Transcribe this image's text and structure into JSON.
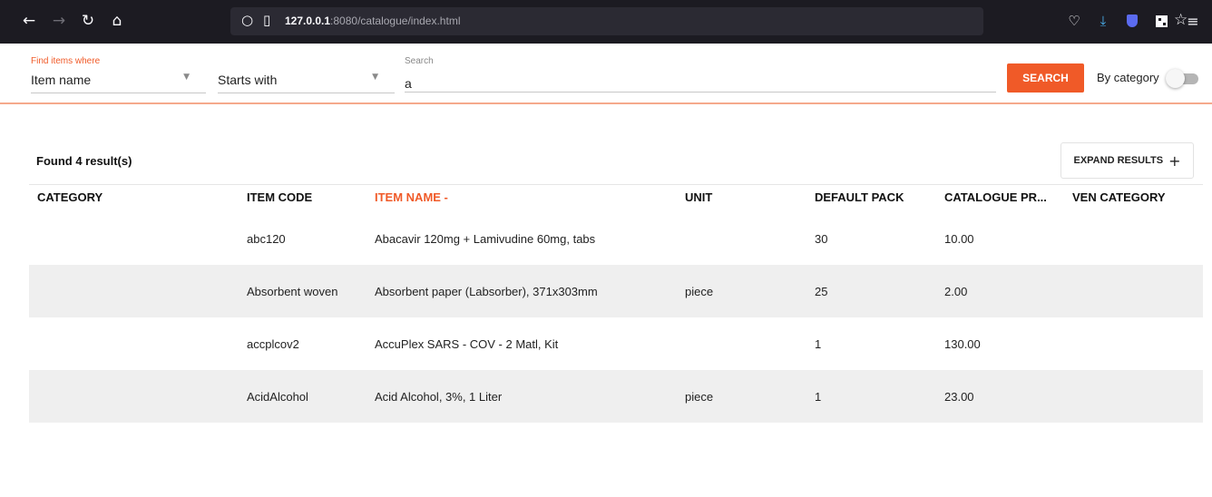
{
  "browser": {
    "url_host": "127.0.0.1",
    "url_rest": ":8080/catalogue/index.html"
  },
  "search": {
    "filter_label": "Find items where",
    "field_value": "Item name",
    "mode_value": "Starts with",
    "search_label": "Search",
    "query": "a",
    "button_label": "SEARCH",
    "category_toggle_label": "By category",
    "category_toggle_on": false
  },
  "results": {
    "count_label": "Found 4 result(s)",
    "expand_label": "EXPAND RESULTS",
    "columns": [
      {
        "label": "CATEGORY"
      },
      {
        "label": "ITEM CODE"
      },
      {
        "label": "ITEM NAME -"
      },
      {
        "label": "UNIT"
      },
      {
        "label": "DEFAULT PACK"
      },
      {
        "label": "CATALOGUE PR..."
      },
      {
        "label": "VEN CATEGORY"
      }
    ],
    "sorted_column": "ITEM NAME -",
    "rows": [
      {
        "category": "",
        "code": "abc120",
        "name": "Abacavir 120mg + Lamivudine 60mg, tabs",
        "unit": "",
        "pack": "30",
        "price": "10.00",
        "ven": ""
      },
      {
        "category": "",
        "code": "Absorbent woven",
        "name": "Absorbent paper (Labsorber), 371x303mm",
        "unit": "piece",
        "pack": "25",
        "price": "2.00",
        "ven": ""
      },
      {
        "category": "",
        "code": "accplcov2",
        "name": "AccuPlex SARS - COV - 2 Matl, Kit",
        "unit": "",
        "pack": "1",
        "price": "130.00",
        "ven": ""
      },
      {
        "category": "",
        "code": "AcidAlcohol",
        "name": "Acid Alcohol, 3%, 1 Liter",
        "unit": "piece",
        "pack": "1",
        "price": "23.00",
        "ven": ""
      }
    ]
  },
  "colors": {
    "accent": "#f05a28",
    "browser_bg": "#1c1b22",
    "row_alt": "#efefef"
  },
  "icons": {
    "back": "arrow-left-icon",
    "forward": "arrow-right-icon",
    "reload": "reload-icon",
    "home": "home-icon",
    "tracking": "shield-outline-icon",
    "page": "page-icon",
    "bookmark": "star-icon",
    "pocket": "pocket-icon",
    "download": "download-icon",
    "extension_shield": "shield-icon",
    "extension_qr": "qr-code-icon",
    "menu": "hamburger-menu-icon",
    "caret": "caret-down-icon",
    "plus": "plus-icon"
  }
}
